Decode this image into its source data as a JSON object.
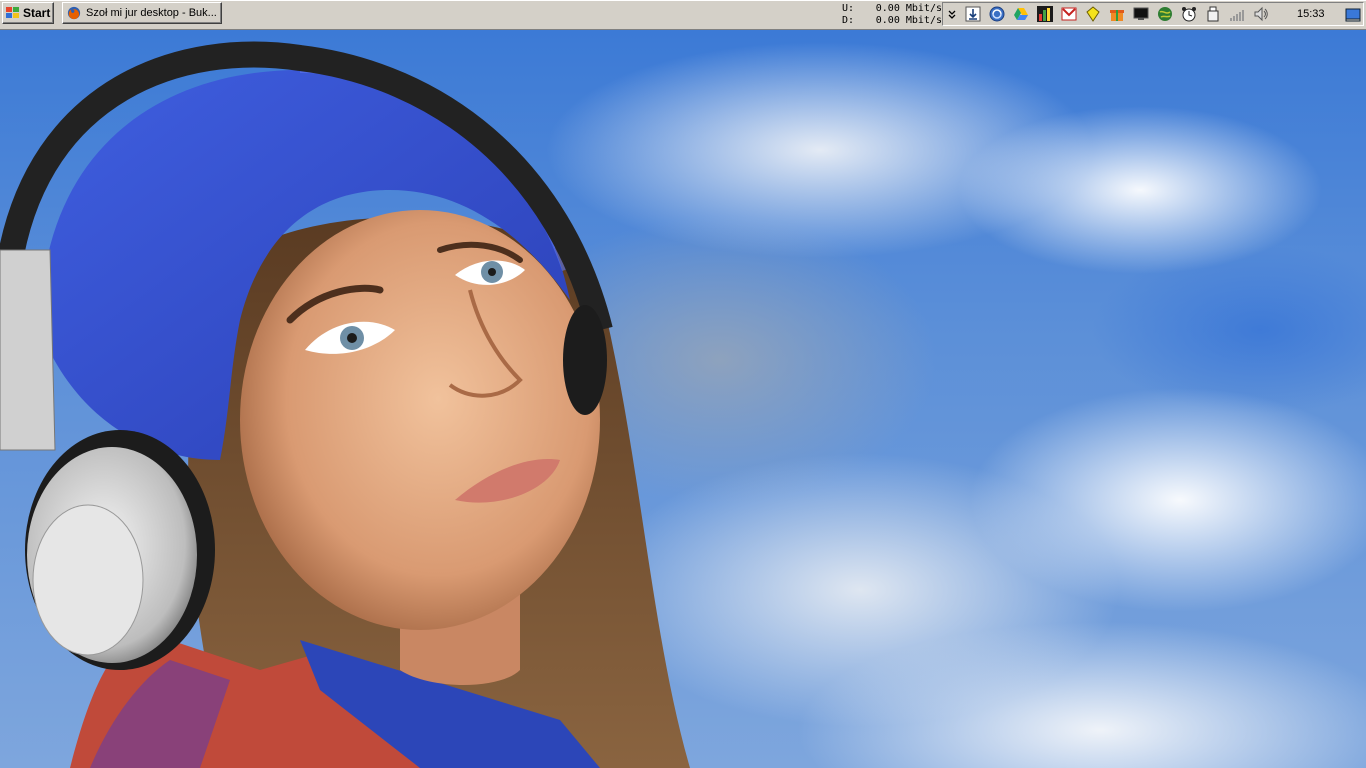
{
  "taskbar": {
    "start_label": "Start",
    "task_button_label": "Szoł mi jur desktop - Buk...",
    "network": {
      "upload_label": "U:",
      "upload_value": "0.00 Mbit/s",
      "download_label": "D:",
      "download_value": "0.00 Mbit/s"
    },
    "tray_icons": [
      "show-hidden-icons-chevron",
      "download-icon",
      "globe-sync-icon",
      "google-drive-icon",
      "bar-graph-icon",
      "gmail-icon",
      "sticky-note-icon",
      "gift-icon",
      "monitor-icon",
      "network-globe-icon",
      "alarm-clock-icon",
      "usb-device-icon",
      "signal-strength-icon",
      "volume-icon"
    ],
    "clock": "15:33"
  },
  "colors": {
    "taskbar_bg": "#d4d0c8",
    "sky_blue": "#3c7ad6",
    "hat_blue": "#3a4fd0"
  }
}
